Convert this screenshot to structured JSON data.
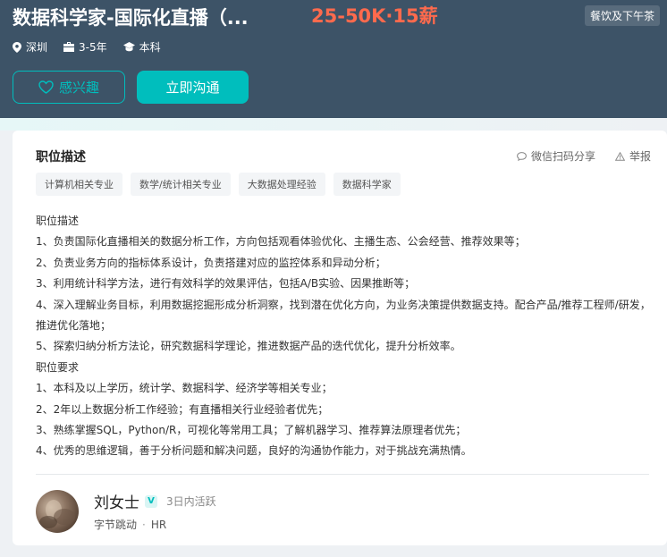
{
  "header": {
    "title": "数据科学家-国际化直播（...",
    "salary": "25-50K·15薪",
    "perk": "餐饮及下午茶",
    "location": "深圳",
    "experience": "3-5年",
    "education": "本科",
    "interest_label": "感兴趣",
    "chat_label": "立即沟通"
  },
  "card": {
    "section_title": "职位描述",
    "share_label": "微信扫码分享",
    "report_label": "举报",
    "tags": [
      "计算机相关专业",
      "数学/统计相关专业",
      "大数据处理经验",
      "数据科学家"
    ],
    "description": [
      "职位描述",
      "1、负责国际化直播相关的数据分析工作，方向包括观看体验优化、主播生态、公会经营、推荐效果等；",
      "2、负责业务方向的指标体系设计，负责搭建对应的监控体系和异动分析；",
      "3、利用统计科学方法，进行有效科学的效果评估，包括A/B实验、因果推断等；",
      "4、深入理解业务目标，利用数据挖掘形成分析洞察，找到潜在优化方向，为业务决策提供数据支持。配合产品/推荐工程师/研发，推进优化落地；",
      "5、探索归纳分析方法论，研究数据科学理论，推进数据产品的迭代优化，提升分析效率。",
      "职位要求",
      "1、本科及以上学历，统计学、数据科学、经济学等相关专业；",
      "2、2年以上数据分析工作经验；有直播相关行业经验者优先；",
      "3、熟练掌握SQL，Python/R，可视化等常用工具；了解机器学习、推荐算法原理者优先；",
      "4、优秀的思维逻辑，善于分析问题和解决问题，良好的沟通协作能力，对于挑战充满热情。"
    ]
  },
  "recruiter": {
    "name": "刘女士",
    "badge": "V",
    "active": "3日内活跃",
    "company": "字节跳动",
    "role": "HR"
  },
  "colors": {
    "header_bg": "#3d5367",
    "accent": "#00bebd",
    "salary": "#ff6a4d"
  }
}
